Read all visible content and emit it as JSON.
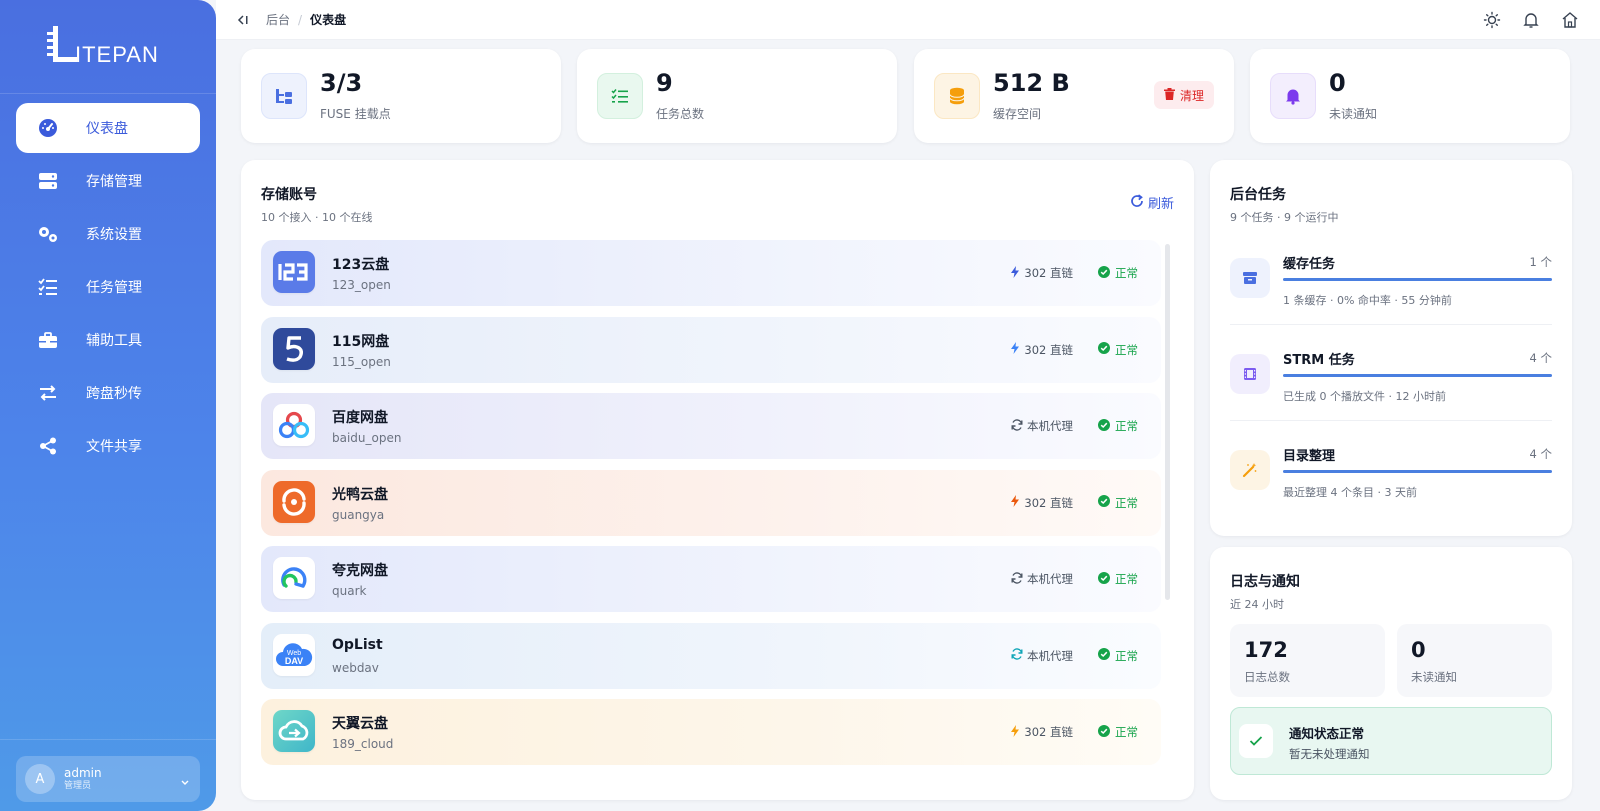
{
  "app": {
    "logo_text": "LITEPAN"
  },
  "sidebar": {
    "items": [
      {
        "label": "仪表盘",
        "icon": "gauge-icon",
        "active": true
      },
      {
        "label": "存储管理",
        "icon": "storage-icon"
      },
      {
        "label": "系统设置",
        "icon": "gears-icon"
      },
      {
        "label": "任务管理",
        "icon": "task-list-icon"
      },
      {
        "label": "辅助工具",
        "icon": "toolbox-icon"
      },
      {
        "label": "跨盘秒传",
        "icon": "transfer-icon"
      },
      {
        "label": "文件共享",
        "icon": "share-icon"
      }
    ],
    "user": {
      "initial": "A",
      "name": "admin",
      "role": "管理员"
    }
  },
  "topbar": {
    "breadcrumb": [
      "后台",
      "仪表盘"
    ],
    "separator": "/",
    "icons": [
      "sun-icon",
      "bell-icon",
      "home-icon"
    ]
  },
  "stats": [
    {
      "value": "3/3",
      "label": "FUSE 挂载点",
      "icon": "mount-icon",
      "color": "#4a6fe0"
    },
    {
      "value": "9",
      "label": "任务总数",
      "icon": "task-list-icon",
      "color": "#16a34a"
    },
    {
      "value": "512 B",
      "label": "缓存空间",
      "icon": "database-icon",
      "color": "#f59e0b",
      "action": "清理"
    },
    {
      "value": "0",
      "label": "未读通知",
      "icon": "bell-icon",
      "color": "#7c3aed"
    }
  ],
  "storage": {
    "title": "存储账号",
    "subtitle": "10 个接入 · 10 个在线",
    "refresh_label": "刷新",
    "accounts": [
      {
        "name": "123云盘",
        "id": "123_open",
        "mode": "302 直链",
        "mode_icon": "bolt-icon",
        "status": "正常",
        "logo": "123"
      },
      {
        "name": "115网盘",
        "id": "115_open",
        "mode": "302 直链",
        "mode_icon": "bolt-icon",
        "status": "正常",
        "logo": "5"
      },
      {
        "name": "百度网盘",
        "id": "baidu_open",
        "mode": "本机代理",
        "mode_icon": "sync-icon",
        "status": "正常",
        "logo": "baidu"
      },
      {
        "name": "光鸭云盘",
        "id": "guangya",
        "mode": "302 直链",
        "mode_icon": "bolt-icon",
        "status": "正常",
        "logo": "guangya"
      },
      {
        "name": "夸克网盘",
        "id": "quark",
        "mode": "本机代理",
        "mode_icon": "sync-icon",
        "status": "正常",
        "logo": "quark"
      },
      {
        "name": "OpList",
        "id": "webdav",
        "mode": "本机代理",
        "mode_icon": "sync-icon",
        "status": "正常",
        "logo": "webdav",
        "logo_text_top": "Web",
        "logo_text_bottom": "DAV"
      },
      {
        "name": "天翼云盘",
        "id": "189_cloud",
        "mode": "302 直链",
        "mode_icon": "bolt-icon",
        "status": "正常",
        "logo": "cloud189"
      }
    ]
  },
  "tasks": {
    "title": "后台任务",
    "subtitle": "9 个任务 · 9 个运行中",
    "items": [
      {
        "name": "缓存任务",
        "count": "1 个",
        "desc": "1 条缓存 · 0% 命中率 · 55 分钟前",
        "icon": "archive-icon",
        "progress": 1.0
      },
      {
        "name": "STRM 任务",
        "count": "4 个",
        "desc": "已生成 0 个播放文件 · 12 小时前",
        "icon": "film-icon",
        "progress": 1.0
      },
      {
        "name": "目录整理",
        "count": "4 个",
        "desc": "最近整理 4 个条目 · 3 天前",
        "icon": "magic-wand-icon",
        "progress": 1.0
      }
    ]
  },
  "logs": {
    "title": "日志与通知",
    "subtitle": "近 24 小时",
    "total_logs": "172",
    "total_logs_label": "日志总数",
    "unread": "0",
    "unread_label": "未读通知",
    "notice_title": "通知状态正常",
    "notice_sub": "暂无未处理通知"
  }
}
